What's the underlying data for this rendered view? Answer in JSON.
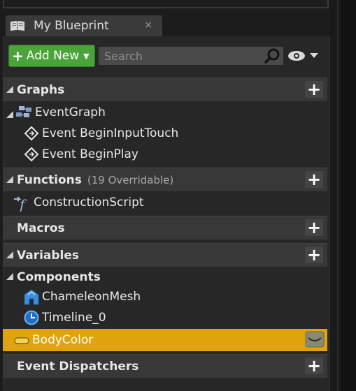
{
  "tab": {
    "title": "My Blueprint",
    "close": "×"
  },
  "toolbar": {
    "add_new_label": "Add New",
    "search_placeholder": "Search"
  },
  "sections": {
    "graphs": {
      "label": "Graphs"
    },
    "functions": {
      "label": "Functions",
      "sub": "(19 Overridable)"
    },
    "macros": {
      "label": "Macros"
    },
    "variables": {
      "label": "Variables"
    },
    "event_dispatchers": {
      "label": "Event Dispatchers"
    }
  },
  "graphs_items": {
    "event_graph": "EventGraph",
    "begin_input_touch": "Event BeginInputTouch",
    "begin_play": "Event BeginPlay"
  },
  "functions_items": {
    "construction_script": "ConstructionScript"
  },
  "variables_items": {
    "components": "Components",
    "chameleon_mesh": "ChameleonMesh",
    "timeline": "Timeline_0",
    "body_color": "BodyColor"
  },
  "colors": {
    "add_button": "#4aa43a",
    "selected_row": "#e0a30e",
    "section_header": "#383838"
  }
}
